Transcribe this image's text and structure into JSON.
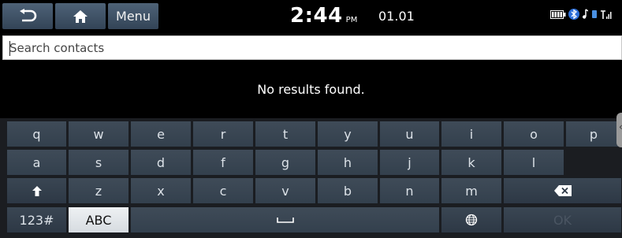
{
  "topbar": {
    "menu_label": "Menu",
    "time": "2:44",
    "ampm": "PM",
    "date": "01.01",
    "icons": [
      "battery-icon",
      "bluetooth-icon",
      "music-note-icon",
      "signal-icon"
    ]
  },
  "search": {
    "placeholder": "Search contacts",
    "value": ""
  },
  "results": {
    "message": "No results found."
  },
  "keyboard": {
    "row1": [
      "q",
      "w",
      "e",
      "r",
      "t",
      "y",
      "u",
      "i",
      "o",
      "p"
    ],
    "row2": [
      "a",
      "s",
      "d",
      "f",
      "g",
      "h",
      "j",
      "k",
      "l"
    ],
    "row3": [
      "z",
      "x",
      "c",
      "v",
      "b",
      "n",
      "m"
    ],
    "mode_numeric": "123#",
    "mode_alpha": "ABC",
    "ok": "OK"
  },
  "colors": {
    "key": "#3a4654",
    "key_active": "#e6e9ec",
    "button": "#41546a",
    "background": "#000000"
  }
}
